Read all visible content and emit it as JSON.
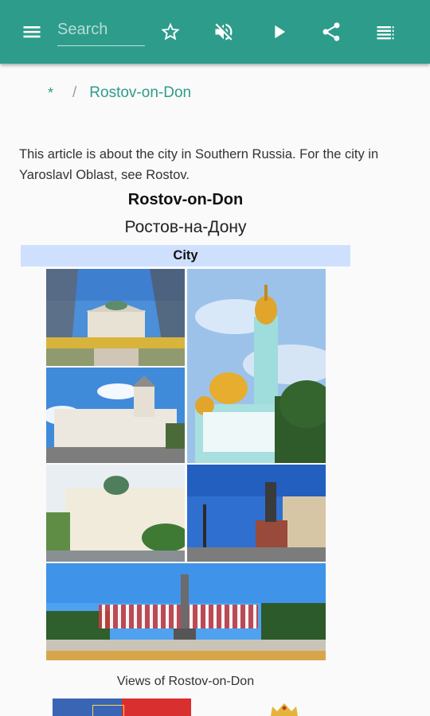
{
  "toolbar": {
    "search_placeholder": "Search",
    "icons": [
      "menu-icon",
      "star-icon",
      "volume-off-icon",
      "play-icon",
      "share-icon",
      "playlist-icon"
    ],
    "accent_color": "#2e9c8b"
  },
  "breadcrumb": {
    "home": "*",
    "separator": "/",
    "current": "Rostov-on-Don"
  },
  "article": {
    "hatnote": "This article is about the city in Southern Russia. For the city in Yaroslavl Oblast, see Rostov.",
    "infobox": {
      "title": "Rostov-on-Don",
      "native_name": "Ростов-на-Дону",
      "type": "City",
      "caption": "Views of Rostov-on-Don"
    }
  }
}
